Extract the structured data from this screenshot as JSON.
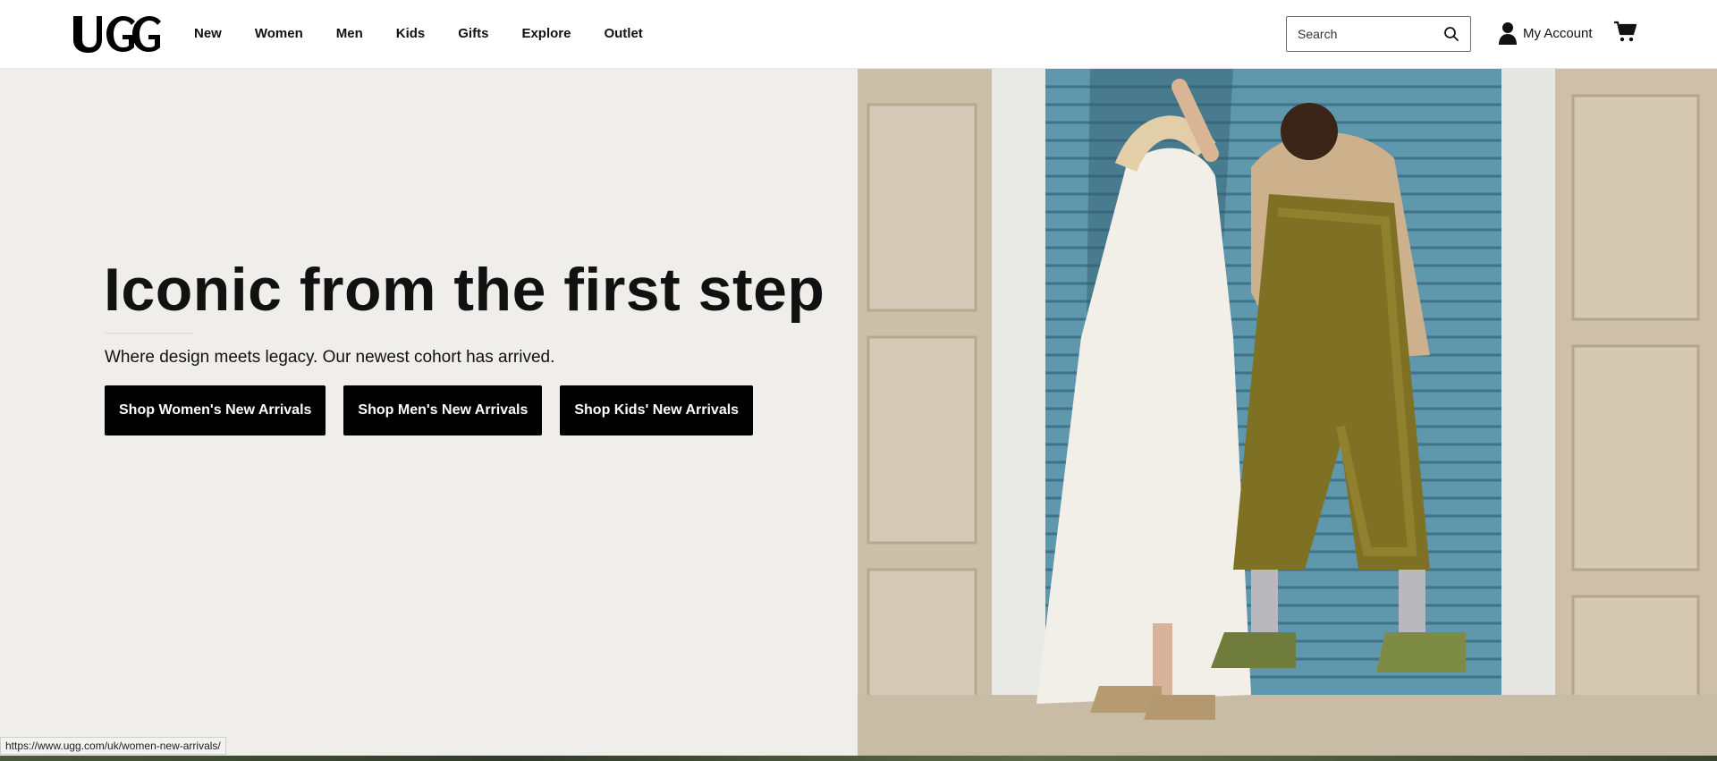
{
  "header": {
    "logo_text": "UGG",
    "nav": [
      "New",
      "Women",
      "Men",
      "Kids",
      "Gifts",
      "Explore",
      "Outlet"
    ],
    "search_placeholder": "Search",
    "account_label": "My Account"
  },
  "hero": {
    "headline": "Iconic from the first step",
    "subtext": "Where design meets legacy. Our newest cohort has arrived.",
    "cta": [
      "Shop Women's New Arrivals",
      "Shop Men's New Arrivals",
      "Shop Kids' New Arrivals"
    ],
    "background_color": "#f0eeeb",
    "image_description": "models-leaning-against-doorway"
  },
  "status_bar": {
    "url": "https://www.ugg.com/uk/women-new-arrivals/"
  },
  "icons": {
    "search": "search-icon",
    "account": "user-icon",
    "cart": "cart-icon"
  }
}
